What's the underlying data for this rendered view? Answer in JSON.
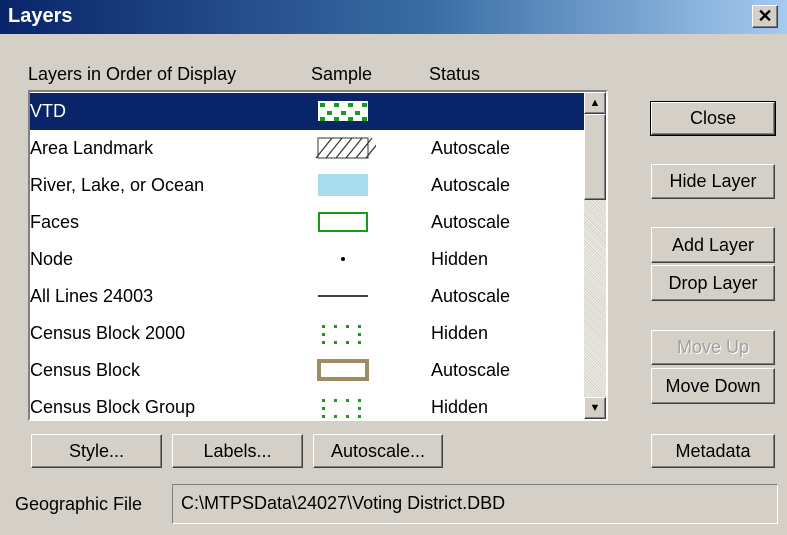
{
  "window": {
    "title": "Layers",
    "close_glyph": "✕"
  },
  "list": {
    "headers": {
      "name": "Layers in Order of Display",
      "sample": "Sample",
      "status": "Status"
    },
    "rows": [
      {
        "name": "VTD",
        "status": "",
        "sample": "green-dots-fill",
        "selected": true
      },
      {
        "name": "Area Landmark",
        "status": "Autoscale",
        "sample": "hatch-box"
      },
      {
        "name": "River, Lake, or Ocean",
        "status": "Autoscale",
        "sample": "light-blue-fill"
      },
      {
        "name": "Faces",
        "status": "Autoscale",
        "sample": "green-outline-box"
      },
      {
        "name": "Node",
        "status": "Hidden",
        "sample": "dot"
      },
      {
        "name": "All Lines 24003",
        "status": "Autoscale",
        "sample": "line"
      },
      {
        "name": "Census Block 2000",
        "status": "Hidden",
        "sample": "green-dotted-box"
      },
      {
        "name": "Census Block",
        "status": "Autoscale",
        "sample": "tan-outline-box"
      },
      {
        "name": "Census Block Group",
        "status": "Hidden",
        "sample": "green-dotted-box"
      }
    ]
  },
  "scrollbar": {
    "up_glyph": "▲",
    "down_glyph": "▼"
  },
  "buttons": {
    "close": "Close",
    "hide_layer": "Hide Layer",
    "add_layer": "Add Layer",
    "drop_layer": "Drop Layer",
    "move_up": "Move Up",
    "move_down": "Move Down",
    "metadata": "Metadata",
    "style": "Style...",
    "labels": "Labels...",
    "autoscale": "Autoscale..."
  },
  "geographic_file": {
    "label": "Geographic File",
    "value": "C:\\MTPSData\\24027\\Voting District.DBD"
  },
  "colors": {
    "selection": "#0a246a",
    "dialog_bg": "#d4d0c8",
    "green_sample": "#1a9a1a",
    "blue_sample": "#a8dcec",
    "tan_sample": "#a08c64"
  }
}
